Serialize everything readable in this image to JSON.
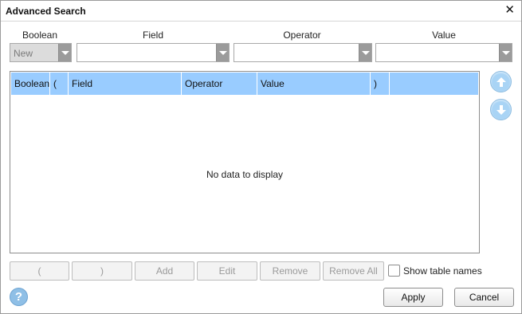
{
  "window": {
    "title": "Advanced Search"
  },
  "columns": {
    "boolean_label": "Boolean",
    "field_label": "Field",
    "operator_label": "Operator",
    "value_label": "Value"
  },
  "filters": {
    "boolean_value": "New",
    "field_value": "",
    "operator_value": "",
    "value_value": ""
  },
  "grid": {
    "headers": [
      "Boolean",
      "(",
      "Field",
      "Operator",
      "Value",
      ")",
      ""
    ],
    "empty_text": "No data to display"
  },
  "buttons": {
    "open_paren": "(",
    "close_paren": ")",
    "add": "Add",
    "edit": "Edit",
    "remove": "Remove",
    "remove_all": "Remove All",
    "apply": "Apply",
    "cancel": "Cancel"
  },
  "options": {
    "show_table_names_label": "Show table names",
    "show_table_names_checked": false
  },
  "icons": {
    "close": "close-icon",
    "move_up": "arrow-up-icon",
    "move_down": "arrow-down-icon",
    "help": "help-icon",
    "dropdown": "chevron-down-icon"
  },
  "colors": {
    "grid_header": "#99ccff",
    "arrow_button": "#a9d4f5",
    "help": "#8fbfe6"
  }
}
